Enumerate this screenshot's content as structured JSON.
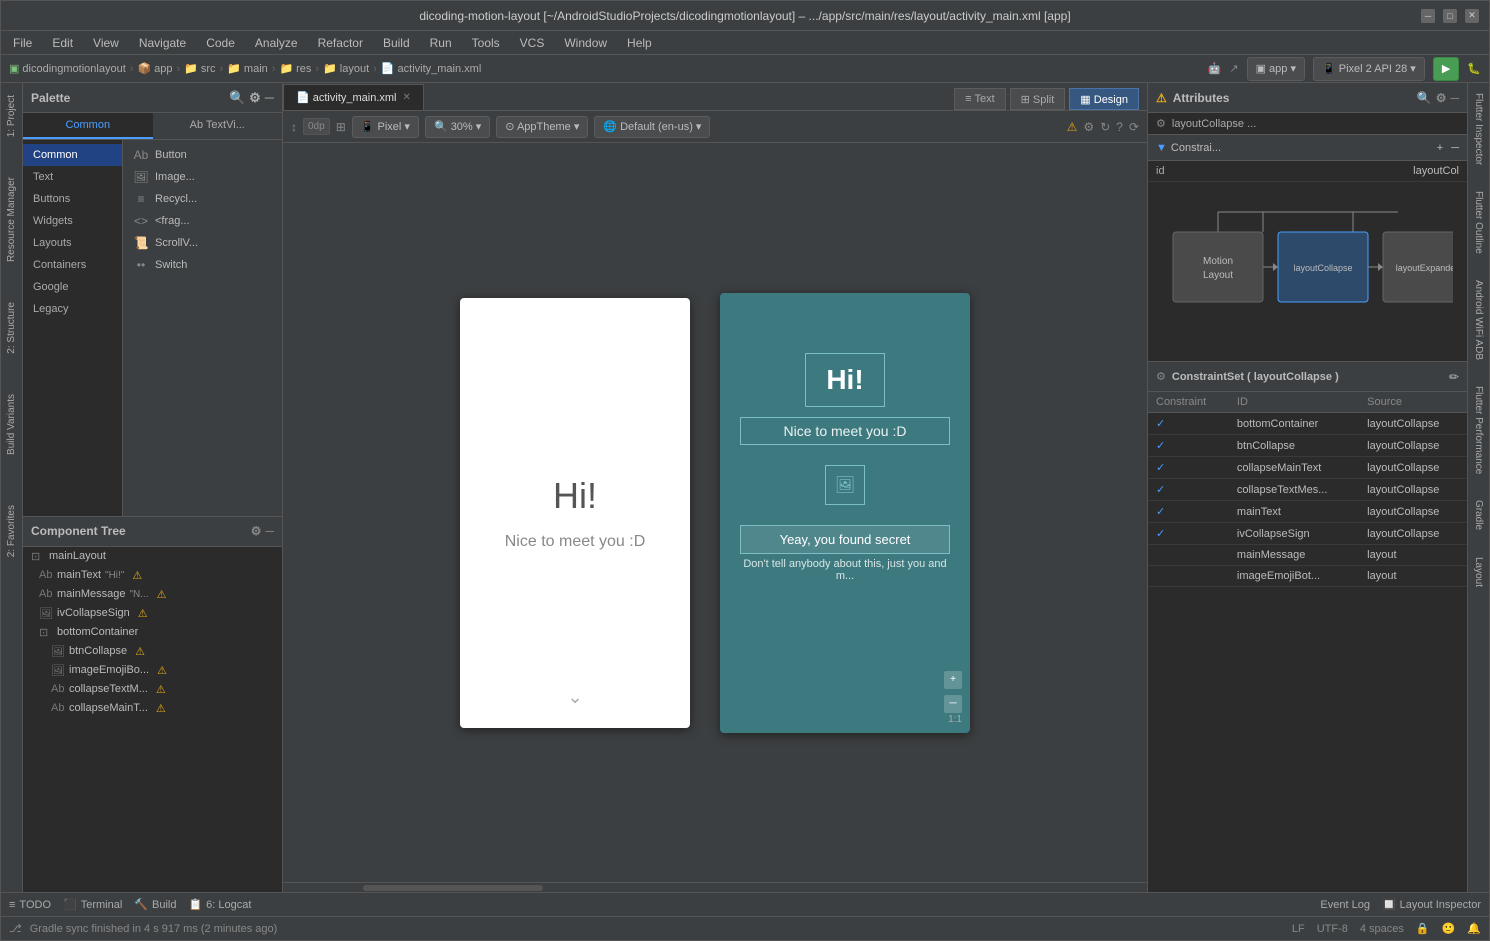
{
  "titlebar": {
    "title": "dicoding-motion-layout [~/AndroidStudioProjects/dicodingmotionlayout] – .../app/src/main/res/layout/activity_main.xml [app]"
  },
  "menubar": {
    "items": [
      "File",
      "Edit",
      "View",
      "Navigate",
      "Code",
      "Analyze",
      "Refactor",
      "Build",
      "Run",
      "Tools",
      "VCS",
      "Window",
      "Help"
    ]
  },
  "breadcrumb": {
    "items": [
      "dicodingmotionlayout",
      "app",
      "src",
      "main",
      "res",
      "layout",
      "activity_main.xml"
    ]
  },
  "toolbar": {
    "app_dropdown": "app",
    "device": "Pixel 2 API 28"
  },
  "palette": {
    "title": "Palette",
    "tabs": [
      {
        "label": "Common",
        "active": true
      },
      {
        "label": "Ab TextVi...",
        "active": false
      }
    ],
    "categories": [
      {
        "label": "Common",
        "active": true
      },
      {
        "label": "Text"
      },
      {
        "label": "Buttons"
      },
      {
        "label": "Widgets"
      },
      {
        "label": "Layouts"
      },
      {
        "label": "Containers"
      },
      {
        "label": "Google"
      },
      {
        "label": "Legacy"
      }
    ],
    "items": [
      {
        "icon": "Ab",
        "label": "Button"
      },
      {
        "icon": "🖼",
        "label": "Image..."
      },
      {
        "icon": "≡",
        "label": "Recycl..."
      },
      {
        "icon": "<>",
        "label": "<frag..."
      },
      {
        "icon": "📜",
        "label": "ScrollV..."
      },
      {
        "icon": "••",
        "label": "Switch"
      }
    ]
  },
  "file_tab": {
    "name": "activity_main.xml",
    "active": true
  },
  "design_toolbar": {
    "pixel": "Pixel",
    "zoom": "30%",
    "theme": "AppTheme",
    "locale": "Default (en-us)",
    "dp": "0dp"
  },
  "view_modes": [
    {
      "label": "Text",
      "icon": "≡"
    },
    {
      "label": "Split",
      "icon": "⊞"
    },
    {
      "label": "Design",
      "icon": "▦",
      "active": true
    }
  ],
  "preview_left": {
    "hi": "Hi!",
    "message": "Nice to meet you :D"
  },
  "preview_right": {
    "hi": "Hi!",
    "message": "Nice to meet you :D",
    "yeay": "Yeay, you found secret",
    "secret": "Don't tell anybody about this, just you and m...",
    "scale": "1:1"
  },
  "attributes_panel": {
    "title": "Attributes",
    "constraint_section": "Constrai...",
    "id_label": "id",
    "id_value": "layoutCol"
  },
  "motion_graph": {
    "nodes": [
      {
        "label": "Motion\nLayout",
        "id": "motion-layout"
      },
      {
        "label": "layoutCollapse",
        "id": "layout-collapse",
        "selected": true
      },
      {
        "label": "layoutExpanded",
        "id": "layout-expanded"
      }
    ]
  },
  "constraint_set": {
    "title": "ConstraintSet ( layoutCollapse )",
    "columns": [
      "Constraint",
      "ID",
      "Source"
    ],
    "rows": [
      {
        "check": true,
        "id": "bottomContainer",
        "source": "layoutCollapse"
      },
      {
        "check": true,
        "id": "btnCollapse",
        "source": "layoutCollapse"
      },
      {
        "check": true,
        "id": "collapseMainText",
        "source": "layoutCollapse"
      },
      {
        "check": true,
        "id": "collapseTextMes...",
        "source": "layoutCollapse"
      },
      {
        "check": true,
        "id": "mainText",
        "source": "layoutCollapse"
      },
      {
        "check": true,
        "id": "ivCollapseSign",
        "source": "layoutCollapse"
      },
      {
        "check": false,
        "id": "mainMessage",
        "source": "layout"
      },
      {
        "check": false,
        "id": "imageEmojiBot...",
        "source": "layout"
      }
    ]
  },
  "component_tree": {
    "title": "Component Tree",
    "items": [
      {
        "level": 0,
        "icon": "⊡",
        "label": "mainLayout"
      },
      {
        "level": 1,
        "icon": "Ab",
        "label": "mainText",
        "value": "\"Hi!\"",
        "warn": true
      },
      {
        "level": 1,
        "icon": "Ab",
        "label": "mainMessage",
        "value": "\"N...",
        "warn": true
      },
      {
        "level": 1,
        "icon": "🖼",
        "label": "ivCollapseSign",
        "warn": true
      },
      {
        "level": 1,
        "icon": "⊡",
        "label": "bottomContainer"
      },
      {
        "level": 2,
        "icon": "🖼",
        "label": "btnCollapse",
        "warn": true
      },
      {
        "level": 2,
        "icon": "🖼",
        "label": "imageEmojiBo...",
        "warn": true
      },
      {
        "level": 2,
        "icon": "Ab",
        "label": "collapseTextM...",
        "warn": true
      },
      {
        "level": 2,
        "icon": "Ab",
        "label": "collapseMainT...",
        "warn": true
      }
    ]
  },
  "bottom_panel": {
    "items": [
      {
        "icon": "≡",
        "label": "TODO"
      },
      {
        "icon": "⬛",
        "label": "Terminal"
      },
      {
        "icon": "🔨",
        "label": "Build"
      },
      {
        "icon": "📋",
        "label": "6: Logcat"
      }
    ],
    "right_items": [
      {
        "label": "Event Log"
      },
      {
        "label": "Layout Inspector"
      }
    ]
  },
  "status_bar": {
    "message": "Gradle sync finished in 4 s 917 ms (2 minutes ago)",
    "right": [
      "LF",
      "UTF-8",
      "4 spaces"
    ]
  }
}
